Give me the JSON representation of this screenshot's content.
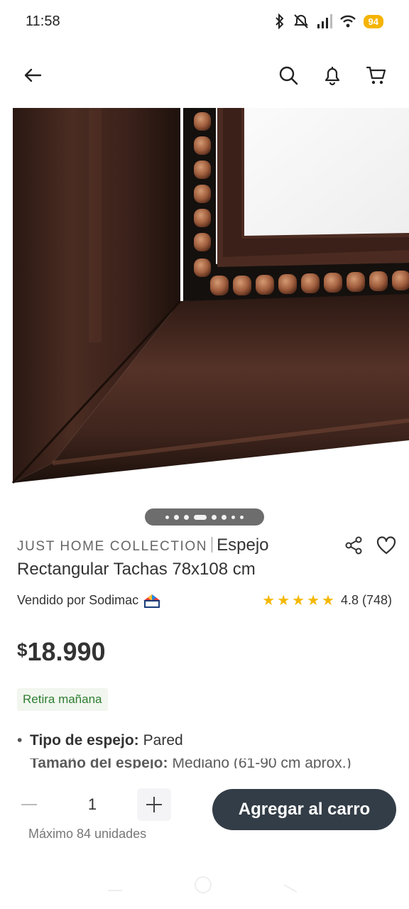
{
  "status_bar": {
    "time": "11:58",
    "battery": "94",
    "icons": [
      "bluetooth-icon",
      "mute-icon",
      "signal-icon",
      "wifi-icon"
    ]
  },
  "header": {
    "icons": [
      "back-arrow-icon",
      "search-icon",
      "bell-icon",
      "cart-icon"
    ]
  },
  "gallery": {
    "image_alt": "Espejo Rectangular Tachas - marco de madera",
    "dots": 8,
    "active_dot": 3
  },
  "product": {
    "brand": "JUST HOME COLLECTION",
    "title": "Espejo Rectangular Tachas 78x108 cm",
    "seller_text": "Vendido por Sodimac",
    "rating_text": "4.8 (748)",
    "rating_value": 4.8,
    "price_currency": "$",
    "price_value": "18.990",
    "pickup_badge": "Retira mañana"
  },
  "specs": [
    {
      "label": "Tipo de espejo:",
      "value": "Pared"
    },
    {
      "label": "Tamaño del espejo:",
      "value": "Mediano (61-90 cm aprox.)"
    }
  ],
  "cart": {
    "quantity": "1",
    "max_text": "Máximo 84 unidades",
    "add_button": "Agregar al carro"
  },
  "colors": {
    "primary_button": "#333d47",
    "star": "#f5b800",
    "badge_text": "#2e7d32",
    "badge_bg": "#f1f6ee"
  }
}
